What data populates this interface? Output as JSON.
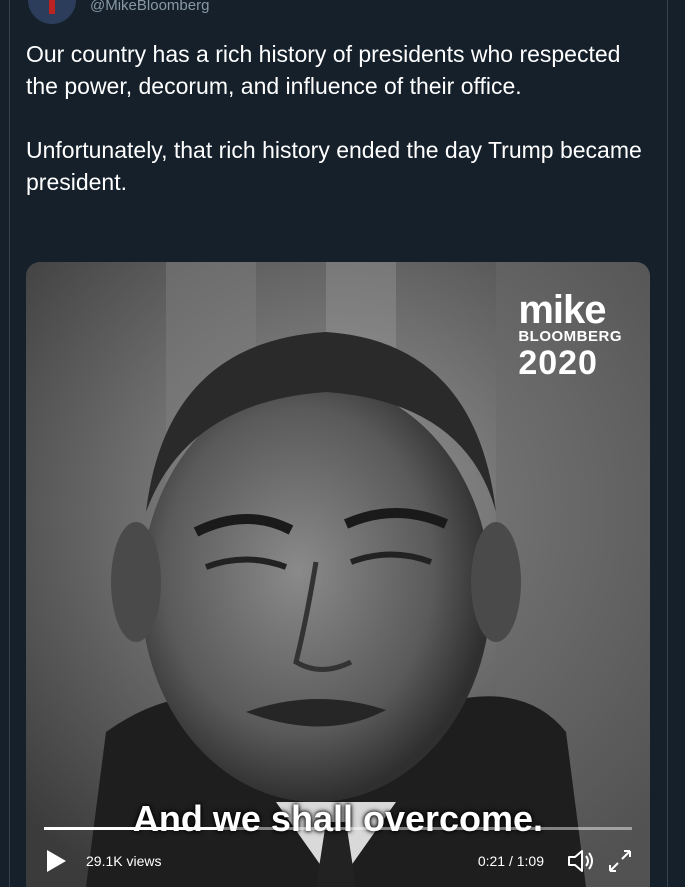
{
  "tweet": {
    "handle": "@MikeBloomberg",
    "text": "Our country has a rich history of presidents who respected the power, decorum, and influence of their office.\n\nUnfortunately, that rich history ended the day Trump became president."
  },
  "video": {
    "logo_line1": "mike",
    "logo_line2": "BLOOMBERG",
    "logo_line3": "2020",
    "caption": "And we shall overcome.",
    "progress": 0.295,
    "views": "29.1K views",
    "time": "0:21 / 1:09"
  },
  "icons": {
    "play": "play-icon",
    "volume": "volume-icon",
    "fullscreen": "fullscreen-icon"
  },
  "colors": {
    "background": "#15202b",
    "border": "#38444d",
    "muted_text": "#8899a6"
  }
}
